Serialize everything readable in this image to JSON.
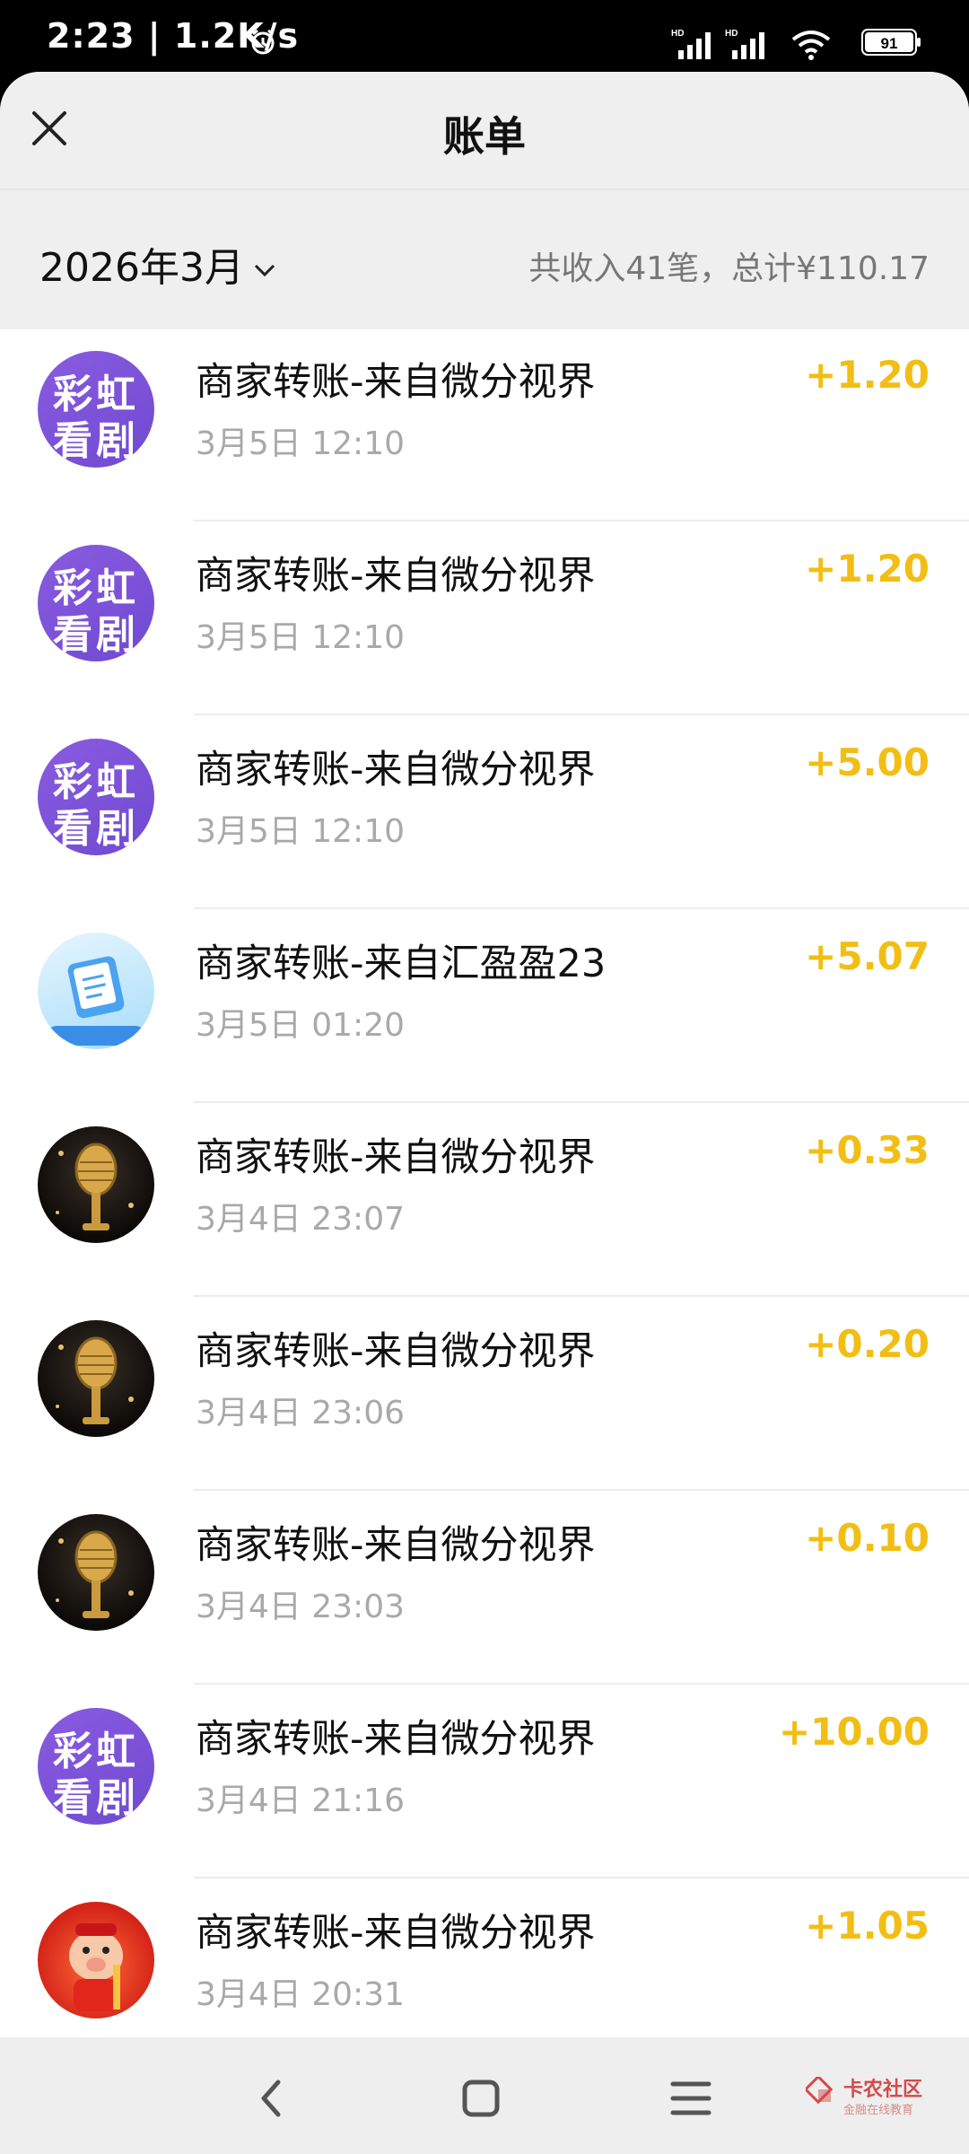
{
  "status": {
    "time": "2:23",
    "speed": "1.2K/s",
    "battery": "91"
  },
  "header": {
    "title": "账单"
  },
  "summary": {
    "month": "2026年3月",
    "totals": "共收入41笔，总计¥110.17"
  },
  "transactions": [
    {
      "name": "商家转账-来自微分视界",
      "time": "3月5日 12:10",
      "amount": "+1.20",
      "avatar": "purple",
      "avatar_text": [
        "彩虹",
        "看剧"
      ]
    },
    {
      "name": "商家转账-来自微分视界",
      "time": "3月5日 12:10",
      "amount": "+1.20",
      "avatar": "purple",
      "avatar_text": [
        "彩虹",
        "看剧"
      ]
    },
    {
      "name": "商家转账-来自微分视界",
      "time": "3月5日 12:10",
      "amount": "+5.00",
      "avatar": "purple",
      "avatar_text": [
        "彩虹",
        "看剧"
      ]
    },
    {
      "name": "商家转账-来自汇盈盈23",
      "time": "3月5日 01:20",
      "amount": "+5.07",
      "avatar": "blue",
      "avatar_text": [
        "",
        ""
      ]
    },
    {
      "name": "商家转账-来自微分视界",
      "time": "3月4日 23:07",
      "amount": "+0.33",
      "avatar": "mic",
      "avatar_text": [
        "",
        ""
      ]
    },
    {
      "name": "商家转账-来自微分视界",
      "time": "3月4日 23:06",
      "amount": "+0.20",
      "avatar": "mic",
      "avatar_text": [
        "",
        ""
      ]
    },
    {
      "name": "商家转账-来自微分视界",
      "time": "3月4日 23:03",
      "amount": "+0.10",
      "avatar": "mic",
      "avatar_text": [
        "",
        ""
      ]
    },
    {
      "name": "商家转账-来自微分视界",
      "time": "3月4日 21:16",
      "amount": "+10.00",
      "avatar": "purple",
      "avatar_text": [
        "彩虹",
        "看剧"
      ]
    },
    {
      "name": "商家转账-来自微分视界",
      "time": "3月4日 20:31",
      "amount": "+1.05",
      "avatar": "red",
      "avatar_text": [
        "",
        ""
      ]
    }
  ],
  "watermark": {
    "line1": "卡农社区",
    "line2": "金融在线教育"
  },
  "colors": {
    "amount": "#f2be14",
    "avatar_purple": "#7a50d8"
  }
}
